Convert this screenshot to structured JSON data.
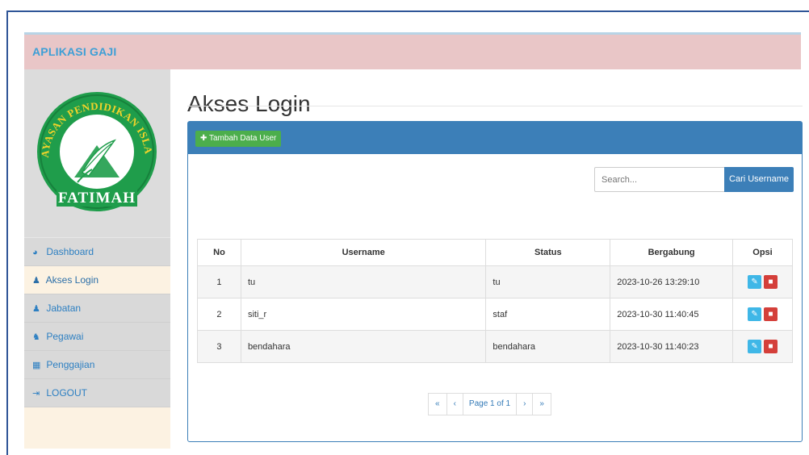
{
  "app": {
    "brand": "APLIKASI GAJI"
  },
  "logo": {
    "top_text": "YAYASAN PENDIDIKAN ISLAM",
    "name": "FATIMAH",
    "green": "#1f9d4b",
    "yellow": "#f2d32a"
  },
  "sidebar": {
    "items": [
      {
        "label": "Dashboard",
        "icon": "dashboard-icon",
        "active": false
      },
      {
        "label": "Akses Login",
        "icon": "user-icon",
        "active": true
      },
      {
        "label": "Jabatan",
        "icon": "user-plus-icon",
        "active": false
      },
      {
        "label": "Pegawai",
        "icon": "users-icon",
        "active": false
      },
      {
        "label": "Penggajian",
        "icon": "calculator-icon",
        "active": false
      },
      {
        "label": "LOGOUT",
        "icon": "sign-out-icon",
        "active": false
      }
    ]
  },
  "page": {
    "title": "Akses Login"
  },
  "toolbar": {
    "add_label": "Tambah Data User"
  },
  "search": {
    "placeholder": "Search...",
    "button_label": "Cari Username"
  },
  "table": {
    "headers": {
      "no": "No",
      "username": "Username",
      "status": "Status",
      "joined": "Bergabung",
      "options": "Opsi"
    },
    "rows": [
      {
        "no": "1",
        "username": "tu",
        "status": "tu",
        "joined": "2023-10-26 13:29:10"
      },
      {
        "no": "2",
        "username": "siti_r",
        "status": "staf",
        "joined": "2023-10-30 11:40:45"
      },
      {
        "no": "3",
        "username": "bendahara",
        "status": "bendahara",
        "joined": "2023-10-30 11:40:23"
      }
    ]
  },
  "pagination": {
    "first": "«",
    "prev": "‹",
    "page_label": "Page 1 of 1",
    "next": "›",
    "last": "»"
  },
  "colors": {
    "topbar": "#e9c6c7",
    "brand": "#3d9fd6",
    "primary": "#3c7fb8",
    "success": "#4cae4c",
    "info": "#3fb7e7",
    "danger": "#d43f3a"
  }
}
